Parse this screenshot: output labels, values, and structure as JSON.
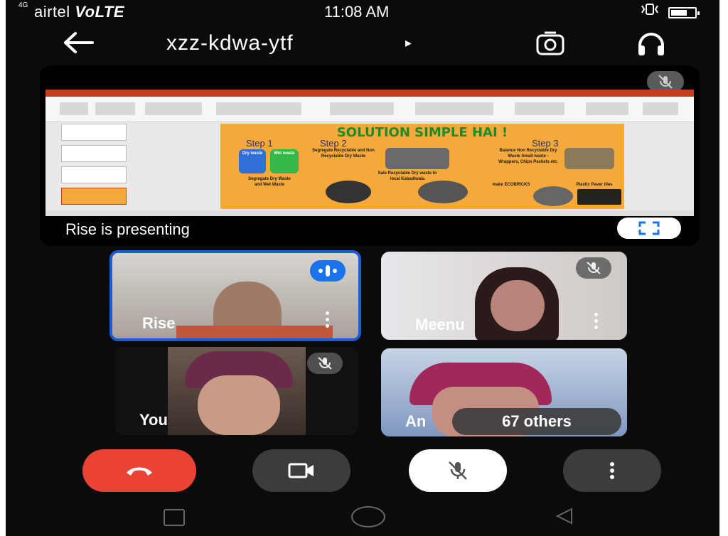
{
  "status_bar": {
    "signal_label": "4G",
    "carrier": "airtel",
    "network": "VoLTE",
    "time": "11:08 AM"
  },
  "app_bar": {
    "meeting_code": "xzz-kdwa-ytf",
    "code_arrow": "▸"
  },
  "presentation": {
    "presenting_label": "Rise is presenting",
    "slide": {
      "title": "SOLUTION SIMPLE HAI !",
      "step1": "Step 1",
      "step2": "Step 2",
      "step3": "Step 3",
      "text_segregate_recyclable": "Segregate Recyclable and Non Recyclable Dry Waste",
      "text_segregate_dry_wet": "Segregate Dry Waste and Wet Waste",
      "text_sale": "Sale Recyclable Dry waste to local Kabadiwala",
      "text_balance": "Balance Non Recyclable Dry Waste Small waste - Wrappers, Chips Packets etc.",
      "text_ecobricks": "make ECOBRICKS",
      "text_plastic_paver": "Plastic Paver tiles",
      "bin_dry": "Dry waste",
      "bin_wet": "Wet waste"
    }
  },
  "participants": [
    {
      "name": "Rise",
      "speaking": true
    },
    {
      "name": "Meenu",
      "muted": true
    },
    {
      "name": "You",
      "muted": true
    },
    {
      "name": "An",
      "muted": false
    }
  ],
  "others_label": "67 others",
  "colors": {
    "end_call": "#ea4335",
    "speaking_accent": "#1a73e8",
    "background": "#0b0b0b"
  }
}
